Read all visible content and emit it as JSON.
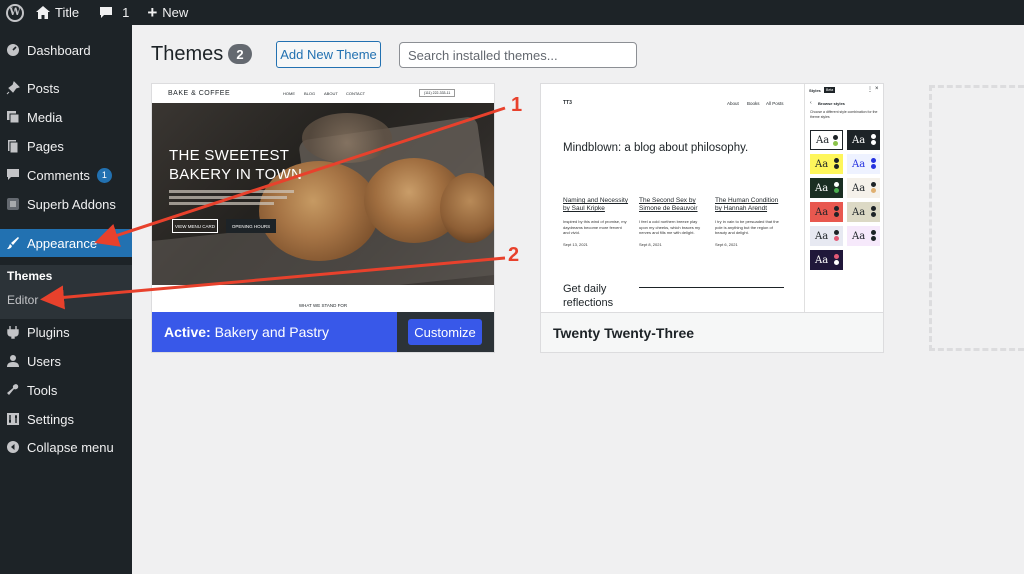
{
  "adminbar": {
    "site_title": "Title",
    "comments_count": "1",
    "new_label": "New"
  },
  "sidebar": {
    "items": [
      {
        "label": "Dashboard"
      },
      {
        "label": "Posts"
      },
      {
        "label": "Media"
      },
      {
        "label": "Pages"
      },
      {
        "label": "Comments",
        "badge": "1"
      },
      {
        "label": "Superb Addons"
      },
      {
        "label": "Appearance"
      },
      {
        "label": "Plugins"
      },
      {
        "label": "Users"
      },
      {
        "label": "Tools"
      },
      {
        "label": "Settings"
      },
      {
        "label": "Collapse menu"
      }
    ],
    "submenu": [
      {
        "label": "Themes"
      },
      {
        "label": "Editor"
      }
    ]
  },
  "main": {
    "title": "Themes",
    "count": "2",
    "add_new_label": "Add New Theme",
    "search_placeholder": "Search installed themes..."
  },
  "themes": [
    {
      "status": "Active:",
      "name": "Bakery and Pastry",
      "customize_label": "Customize",
      "preview": {
        "brand": "BAKE & COFFEE",
        "nav": [
          "HOME",
          "BLOG",
          "ABOUT",
          "CONTACT"
        ],
        "phone": "(111) 222-333-11",
        "headline_1": "THE SWEETEST",
        "headline_2": "BAKERY IN TOWN",
        "button_1": "VIEW MENU CARD",
        "button_2": "OPENING HOURS",
        "section_label": "WHAT WE STAND FOR"
      }
    },
    {
      "name": "Twenty Twenty-Three",
      "preview": {
        "logo": "TT3",
        "nav": [
          "About",
          "Books",
          "All Posts"
        ],
        "heading": "Mindblown: a blog about philosophy.",
        "posts": [
          {
            "title": "Naming and Necessity by Saul Kripke",
            "excerpt": "Inspired by this wind of promise, my daydreams become more fervent and vivid.",
            "date": "Sept 13, 2021"
          },
          {
            "title": "The Second Sex by Simone de Beauvoir",
            "excerpt": "I feel a cold northern breeze play upon my cheeks, which braces my nerves and fills me with delight.",
            "date": "Sept 8, 2021"
          },
          {
            "title": "The Human Condition by Hannah Arendt",
            "excerpt": "I try in vain to be persuaded that the pole is anything but the region of beauty and delight.",
            "date": "Sept 6, 2021"
          }
        ],
        "cta": "Get daily reflections",
        "styles_title": "Styles",
        "styles_badge": "Beta",
        "browse_styles": "Browse styles",
        "browse_desc": "Choose a different style combination for the theme styles",
        "swatch_label": "Aa"
      }
    }
  ],
  "annotations": [
    {
      "number": "1",
      "color": "#e8412c"
    },
    {
      "number": "2",
      "color": "#e8412c"
    }
  ],
  "colors": {
    "admin_dark": "#1d2327",
    "wp_blue": "#2271b1",
    "active_theme_blue": "#3858e9",
    "arrow_red": "#e8412c"
  }
}
